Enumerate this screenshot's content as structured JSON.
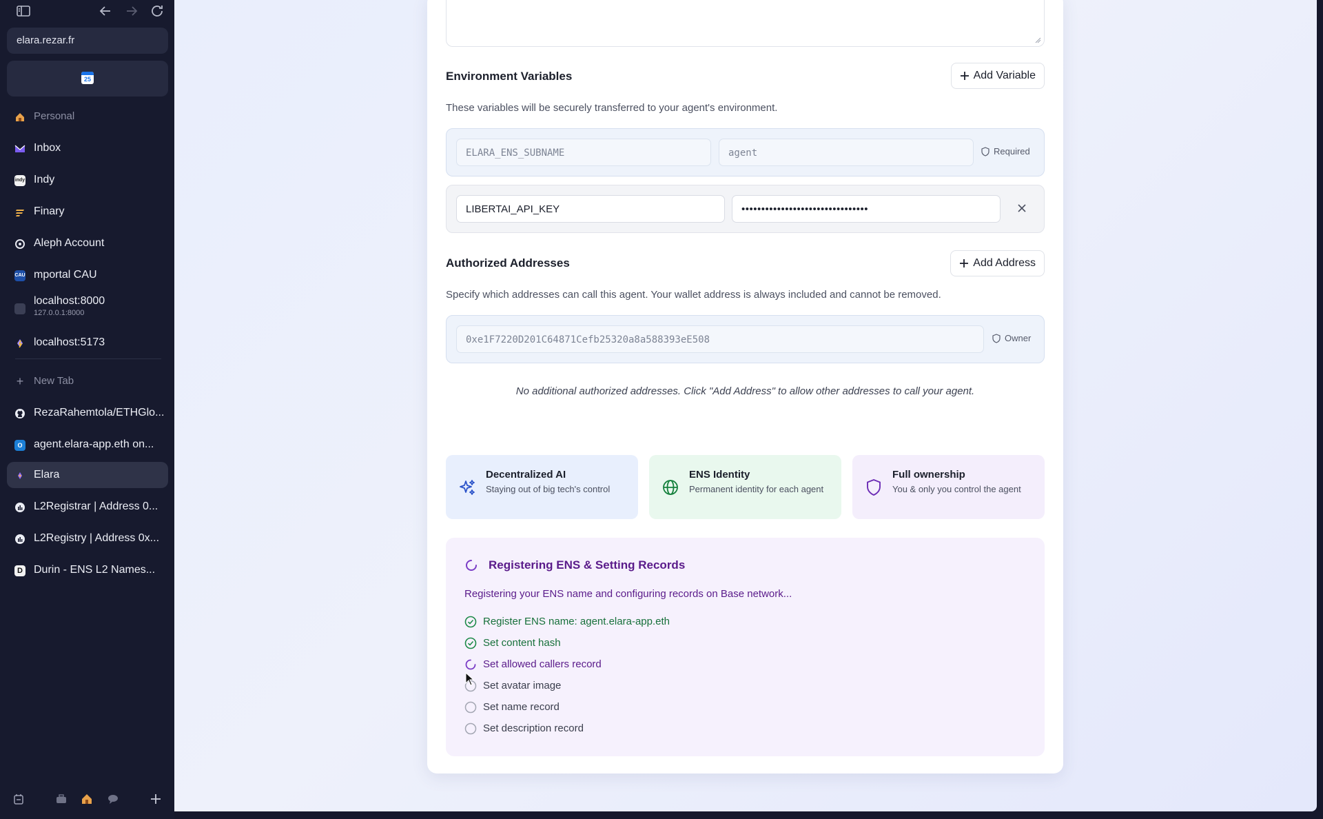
{
  "browser": {
    "url": "elara.rezar.fr",
    "pinned_calendar_day": "25",
    "nav_items": [
      {
        "label": "Personal",
        "icon": "house-icon"
      },
      {
        "label": "Inbox",
        "icon": "mail-icon"
      },
      {
        "label": "Indy",
        "icon": "indy-icon"
      },
      {
        "label": "Finary",
        "icon": "finary-icon"
      },
      {
        "label": "Aleph Account",
        "icon": "aleph-icon"
      },
      {
        "label": "mportal CAU",
        "icon": "cau-icon"
      },
      {
        "label": "localhost:8000",
        "sub": "127.0.0.1:8000",
        "icon": "page-icon"
      },
      {
        "label": "localhost:5173",
        "icon": "vite-icon"
      }
    ],
    "new_tab_label": "New Tab",
    "tabs": [
      {
        "label": "RezaRahemtola/ETHGlo...",
        "icon": "github-icon"
      },
      {
        "label": "agent.elara-app.eth on...",
        "icon": "ens-icon"
      },
      {
        "label": "Elara",
        "icon": "elara-icon",
        "active": true
      },
      {
        "label": "L2Registrar | Address 0...",
        "icon": "explorer-icon"
      },
      {
        "label": "L2Registry | Address 0x...",
        "icon": "explorer-icon"
      },
      {
        "label": "Durin - ENS L2 Names...",
        "icon": "durin-icon"
      }
    ]
  },
  "env": {
    "title": "Environment Variables",
    "add_label": "Add Variable",
    "description": "These variables will be securely transferred to your agent's environment.",
    "rows": [
      {
        "key": "ELARA_ENS_SUBNAME",
        "value": "agent",
        "tag": "Required"
      },
      {
        "key": "LIBERTAI_API_KEY",
        "value": "••••••••••••••••••••••••••••••••"
      }
    ]
  },
  "addresses": {
    "title": "Authorized Addresses",
    "add_label": "Add Address",
    "description": "Specify which addresses can call this agent. Your wallet address is always included and cannot be removed.",
    "owner_address": "0xe1F7220D201C64871Cefb25320a8a588393eE508",
    "owner_tag": "Owner",
    "empty_note": "No additional authorized addresses. Click \"Add Address\" to allow other addresses to call your agent."
  },
  "features": [
    {
      "title": "Decentralized AI",
      "desc": "Staying out of big tech's control",
      "bg": "#e8effd",
      "color": "#2a52c9",
      "icon": "sparkles-icon"
    },
    {
      "title": "ENS Identity",
      "desc": "Permanent identity for each agent",
      "bg": "#e9f8ee",
      "color": "#16813d",
      "icon": "globe-icon"
    },
    {
      "title": "Full ownership",
      "desc": "You & only you control the agent",
      "bg": "#f4eefc",
      "color": "#6b2bb5",
      "icon": "shield-icon"
    }
  ],
  "progress": {
    "title": "Registering ENS & Setting Records",
    "description": "Registering your ENS name and configuring records on Base network...",
    "steps": [
      {
        "label": "Register ENS name: agent.elara-app.eth",
        "status": "done"
      },
      {
        "label": "Set content hash",
        "status": "done"
      },
      {
        "label": "Set allowed callers record",
        "status": "active"
      },
      {
        "label": "Set avatar image",
        "status": "pending"
      },
      {
        "label": "Set name record",
        "status": "pending"
      },
      {
        "label": "Set description record",
        "status": "pending"
      }
    ]
  }
}
